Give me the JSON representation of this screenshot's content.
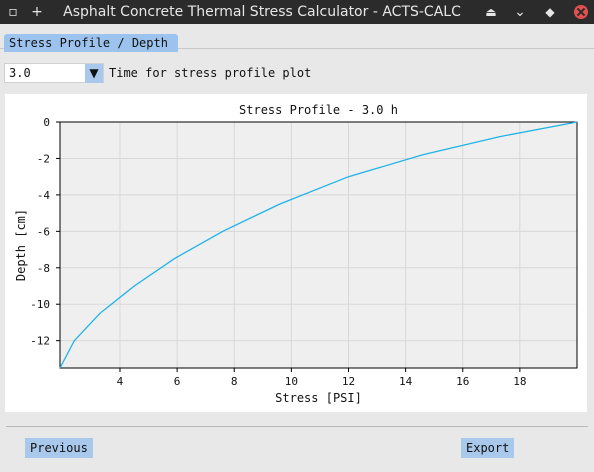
{
  "window": {
    "title": "Asphalt Concrete Thermal Stress Calculator - ACTS-CALC",
    "left_icons": [
      "square-icon",
      "plus-icon"
    ],
    "right_icons": [
      "eject-icon",
      "minimize-icon",
      "maximize-icon",
      "close-icon"
    ]
  },
  "tabs": [
    {
      "label": "Stress Profile / Depth"
    }
  ],
  "time_select": {
    "value": "3.0",
    "label": "Time for stress profile plot"
  },
  "footer": {
    "previous_label": "Previous",
    "export_label": "Export"
  },
  "chart_data": {
    "type": "line",
    "title": "Stress Profile - 3.0 h",
    "xlabel": "Stress [PSI]",
    "ylabel": "Depth [cm]",
    "xlim": [
      1.9,
      20
    ],
    "ylim": [
      -13.5,
      0
    ],
    "xticks": [
      4,
      6,
      8,
      10,
      12,
      14,
      16,
      18
    ],
    "yticks": [
      0,
      -2,
      -4,
      -6,
      -8,
      -10,
      -12
    ],
    "grid": true,
    "series": [
      {
        "color": "#1fb3e6",
        "x": [
          1.9,
          2.4,
          3.3,
          4.5,
          5.9,
          7.6,
          9.6,
          12.0,
          14.6,
          17.3,
          20.0
        ],
        "y": [
          -13.5,
          -12.0,
          -10.5,
          -9.0,
          -7.5,
          -6.0,
          -4.5,
          -3.0,
          -1.8,
          -0.8,
          0.0
        ]
      }
    ]
  }
}
